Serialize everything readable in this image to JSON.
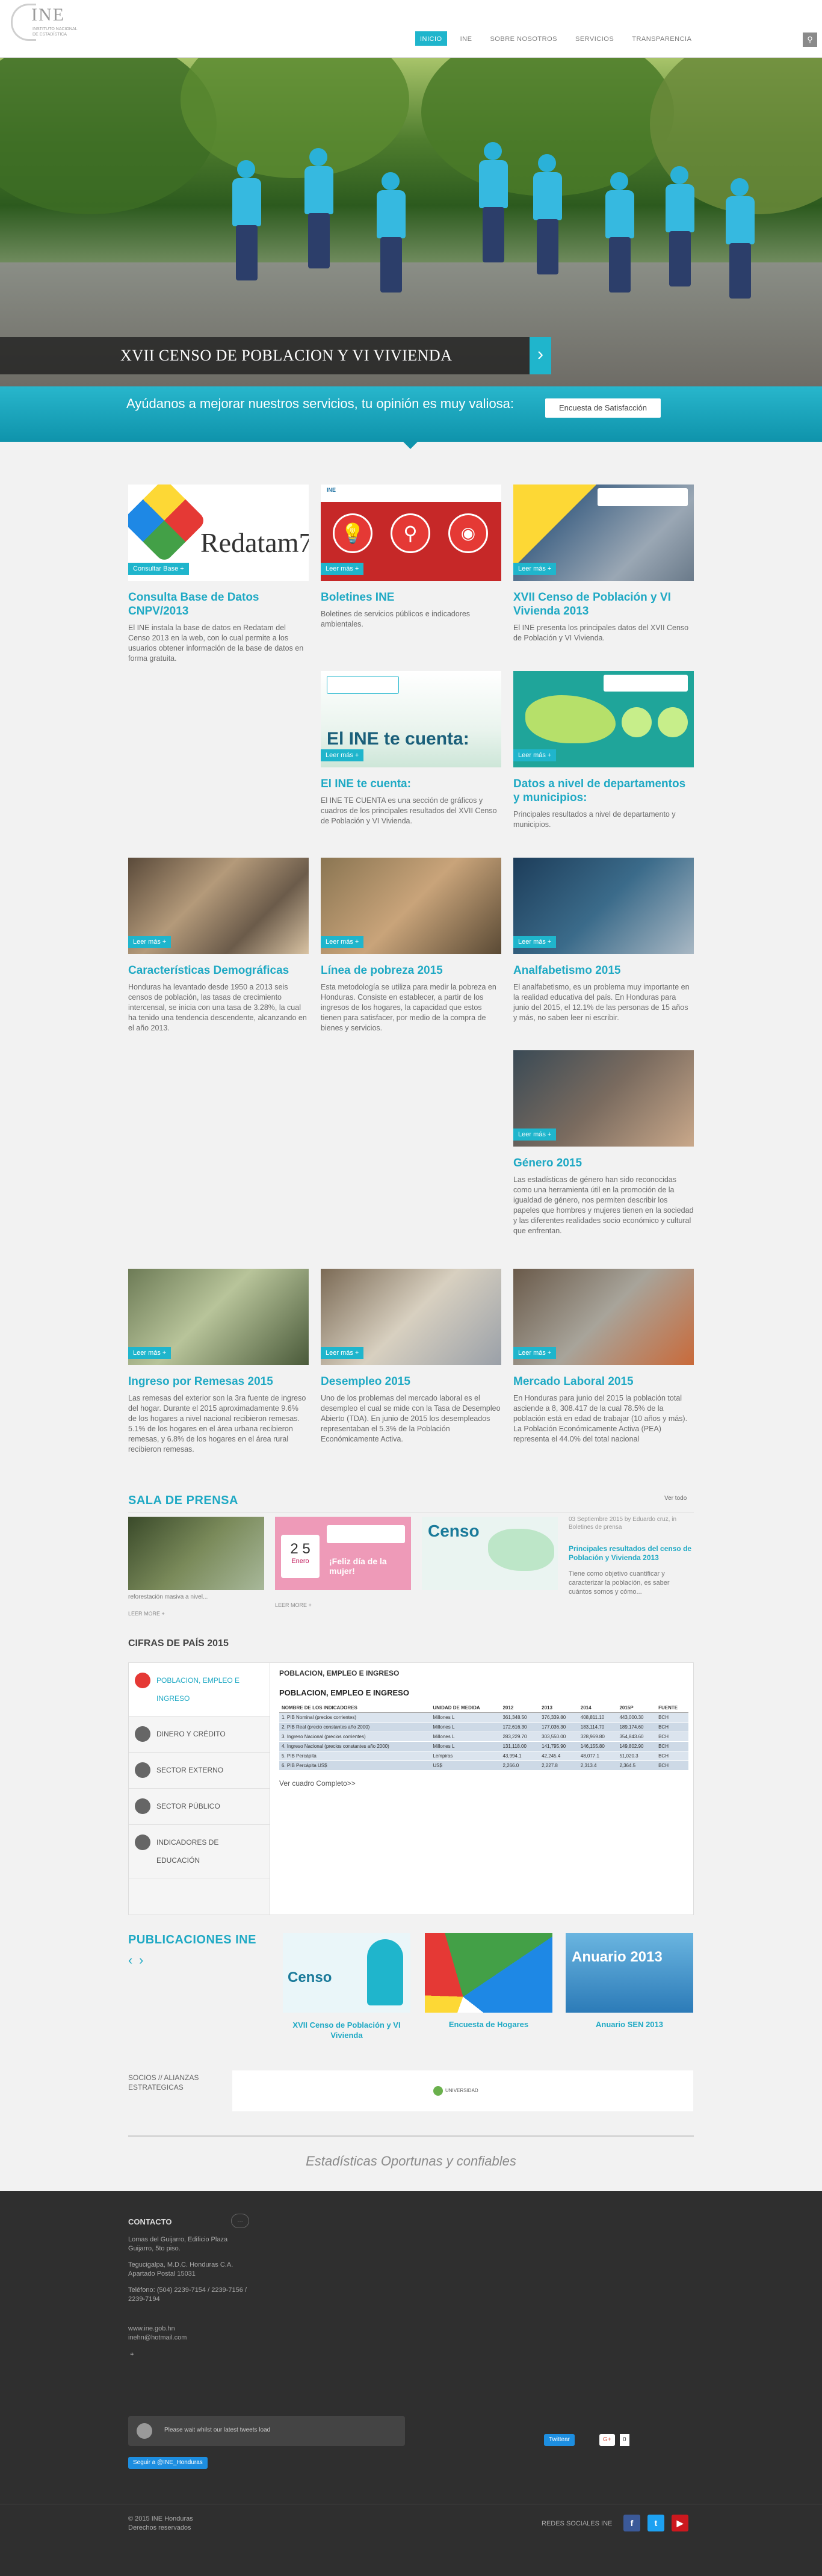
{
  "header": {
    "logo_text": "INE",
    "logo_sub": "INSTITUTO NACIONAL DE ESTADÍSTICA",
    "nav": [
      "INICIO",
      "INE",
      "SOBRE NOSOTROS",
      "SERVICIOS",
      "TRANSPARENCIA"
    ],
    "search_icon": "magnifier-icon"
  },
  "hero": {
    "caption": "XVII CENSO DE POBLACION Y VI VIVIENDA",
    "next_icon": "chevron-right-icon"
  },
  "survey": {
    "text": "Ayúdanos a mejorar nuestros servicios, tu opinión es muy valiosa:",
    "button": "Encuesta de Satisfacción"
  },
  "cards": [
    {
      "more": "Consultar Base +",
      "title": "Consulta Base de Datos CNPV/2013",
      "text": "El INE instala la base de datos en Redatam del Censo 2013 en la web, con lo cual permite a los usuarios obtener información de la base de datos en forma gratuita.",
      "img_text": "Redatam7"
    },
    {
      "more": "Leer más +",
      "title": "Boletines INE",
      "text": "Boletines de servicios públicos e indicadores ambientales."
    },
    {
      "more": "Leer más +",
      "title": "XVII Censo de Población y VI Vivienda 2013",
      "text": "El INE presenta los principales datos del XVII Censo de Población y VI Vivienda."
    },
    {
      "more": "Leer más +",
      "title": "El INE te cuenta:",
      "text": "El INE TE CUENTA es una sección de gráficos y cuadros de los principales resultados del XVII Censo de Población y VI Vivienda.",
      "img_text": "El INE te cuenta:"
    },
    {
      "more": "Leer más +",
      "title": "Datos a nivel de departamentos y municipios:",
      "text": "Principales resultados a nivel de departamento y municipios."
    },
    {
      "more": "Leer más +",
      "title": "Características Demográficas",
      "text": "Honduras ha levantado desde 1950 a 2013 seis censos de población, las tasas de crecimiento intercensal, se inicia con una tasa de 3.28%, la cual ha tenido una tendencia descendente, alcanzando en el año 2013."
    },
    {
      "more": "Leer más +",
      "title": "Línea de pobreza 2015",
      "text": "Esta metodología se utiliza para medir la pobreza en Honduras. Consiste en establecer, a partir de los ingresos de los hogares, la capacidad que estos tienen para satisfacer, por medio de la compra de bienes y servicios."
    },
    {
      "more": "Leer más +",
      "title": "Analfabetismo 2015",
      "text": "El analfabetismo, es un problema muy importante en la realidad educativa del país. En Honduras para junio del 2015, el 12.1% de las personas de 15 años y más, no saben leer ni escribir."
    },
    {
      "more": "Leer más +",
      "title": "Género 2015",
      "text": "Las estadísticas de género han sido reconocidas como una herramienta útil en la promoción de la igualdad de género, nos permiten describir los papeles que hombres y mujeres tienen en la sociedad y las diferentes realidades socio económico y cultural que enfrentan."
    },
    {
      "more": "Leer más +",
      "title": "Ingreso por Remesas 2015",
      "text": "Las remesas del exterior son la 3ra fuente de ingreso del hogar. Durante el 2015 aproximadamente 9.6% de los hogares a nivel nacional recibieron remesas. 5.1% de los hogares en el área urbana recibieron remesas, y 6.8% de los hogares en el área rural recibieron remesas."
    },
    {
      "more": "Leer más +",
      "title": "Desempleo 2015",
      "text": "Uno de los problemas del mercado laboral es el desempleo el cual se mide con la Tasa de Desempleo Abierto (TDA). En junio de 2015 los desempleados representaban el 5.3% de la Población Económicamente Activa."
    },
    {
      "more": "Leer más +",
      "title": "Mercado Laboral 2015",
      "text": "En Honduras para junio del 2015 la población total asciende a 8, 308.417 de la cual 78.5% de la población está en edad de trabajar (10 años y más). La Población Económicamente Activa (PEA) representa el 44.0% del total nacional"
    }
  ],
  "press": {
    "title": "SALA DE PRENSA",
    "view_all": "Ver todo",
    "items": [
      {
        "caption": "reforestación masiva a nivel...",
        "more": "LEER MORE +"
      },
      {
        "caption": "",
        "more": "LEER MORE +",
        "img_text": "¡Feliz día de la mujer!"
      },
      {
        "caption": "",
        "more": "",
        "img_text": "Censo"
      }
    ],
    "side": {
      "meta": "03 Septiembre 2015 by Eduardo cruz, in Boletines de prensa",
      "link": "Principales resultados del censo de Población y Vivienda 2013",
      "text": "Tiene como objetivo cuantificar y caracterizar la población, es saber cuántos somos y cómo..."
    },
    "calendar": {
      "day": "2 5",
      "month": "Enero"
    }
  },
  "cifras": {
    "title": "CIFRAS DE PAÍS 2015",
    "menu": [
      {
        "label": "POBLACION, EMPLEO E INGRESO",
        "icon": "people-icon"
      },
      {
        "label": "DINERO Y CRÉDITO",
        "icon": "money-icon"
      },
      {
        "label": "SECTOR EXTERNO",
        "icon": "globe-icon"
      },
      {
        "label": "SECTOR PÚBLICO",
        "icon": "building-icon"
      },
      {
        "label": "INDICADORES DE EDUCACIÓN",
        "icon": "book-icon"
      }
    ],
    "heading": "POBLACION, EMPLEO E INGRESO",
    "table_title": "POBLACION, EMPLEO E INGRESO",
    "columns": [
      "NOMBRE DE LOS INDICADORES",
      "UNIDAD DE MEDIDA",
      "2012",
      "2013",
      "2014",
      "2015P",
      "FUENTE"
    ],
    "rows": [
      [
        "1. PIB Nominal (precios corrientes)",
        "Millones L",
        "361,348.50",
        "376,339.80",
        "408,811.10",
        "443,000.30",
        "BCH"
      ],
      [
        "2. PIB Real (precio constantes año 2000)",
        "Millones L",
        "172,616.30",
        "177,036.30",
        "183,114.70",
        "189,174.60",
        "BCH"
      ],
      [
        "3. Ingreso Nacional (precios corrientes)",
        "Millones L",
        "283,229.70",
        "303,550.00",
        "328,969.80",
        "354,843.60",
        "BCH"
      ],
      [
        "4. Ingreso Nacional (precios constantes año 2000)",
        "Millones L",
        "131,118.00",
        "141,795.90",
        "146,155.80",
        "149,802.90",
        "BCH"
      ],
      [
        "5. PIB Percápita",
        "Lempiras",
        "43,994.1",
        "42,245.4",
        "48,077.1",
        "51,020.3",
        "BCH"
      ],
      [
        "6. PIB Percápita US$",
        "US$",
        "2,266.0",
        "2,227.8",
        "2,313.4",
        "2,364.5",
        "BCH"
      ]
    ],
    "link": "Ver cuadro Completo>>"
  },
  "publications": {
    "title": "PUBLICACIONES INE",
    "items": [
      {
        "label": "XVII Censo de Población y VI Vivienda",
        "img_text": "Censo"
      },
      {
        "label": "Encuesta de Hogares",
        "img_text": ""
      },
      {
        "label": "Anuario SEN 2013",
        "img_text": "Anuario 2013"
      }
    ],
    "arrows": [
      "‹",
      "›"
    ]
  },
  "partners": {
    "title": "SOCIOS // ALIANZAS ESTRATEGICAS",
    "logo_text": "UNIVERSIDAD"
  },
  "slogan": "Estadísticas Oportunas y confiables",
  "footer": {
    "contact_title": "CONTACTO",
    "address": "Lomas del Guijarro, Edificio Plaza Guijarro, 5to piso.",
    "city": "Tegucigalpa, M.D.C. Honduras C.A. Apartado Postal 15031",
    "phones": "Teléfono: (504) 2239-7154 / 2239-7156 / 2239-7194",
    "web": "www.ine.gob.hn",
    "email": "inehn@hotmail.com",
    "tweet": "Please wait whilst our latest tweets load",
    "follow": "Seguir a @INE_Honduras",
    "twitter_btn": "Twittear",
    "gplus_btn": "G+",
    "gplus_count": "0",
    "copyright": "© 2015 INE Honduras",
    "rights": "Derechos reservados",
    "social_label": "REDES SOCIALES INE",
    "social": [
      "f",
      "t",
      "▶"
    ]
  }
}
